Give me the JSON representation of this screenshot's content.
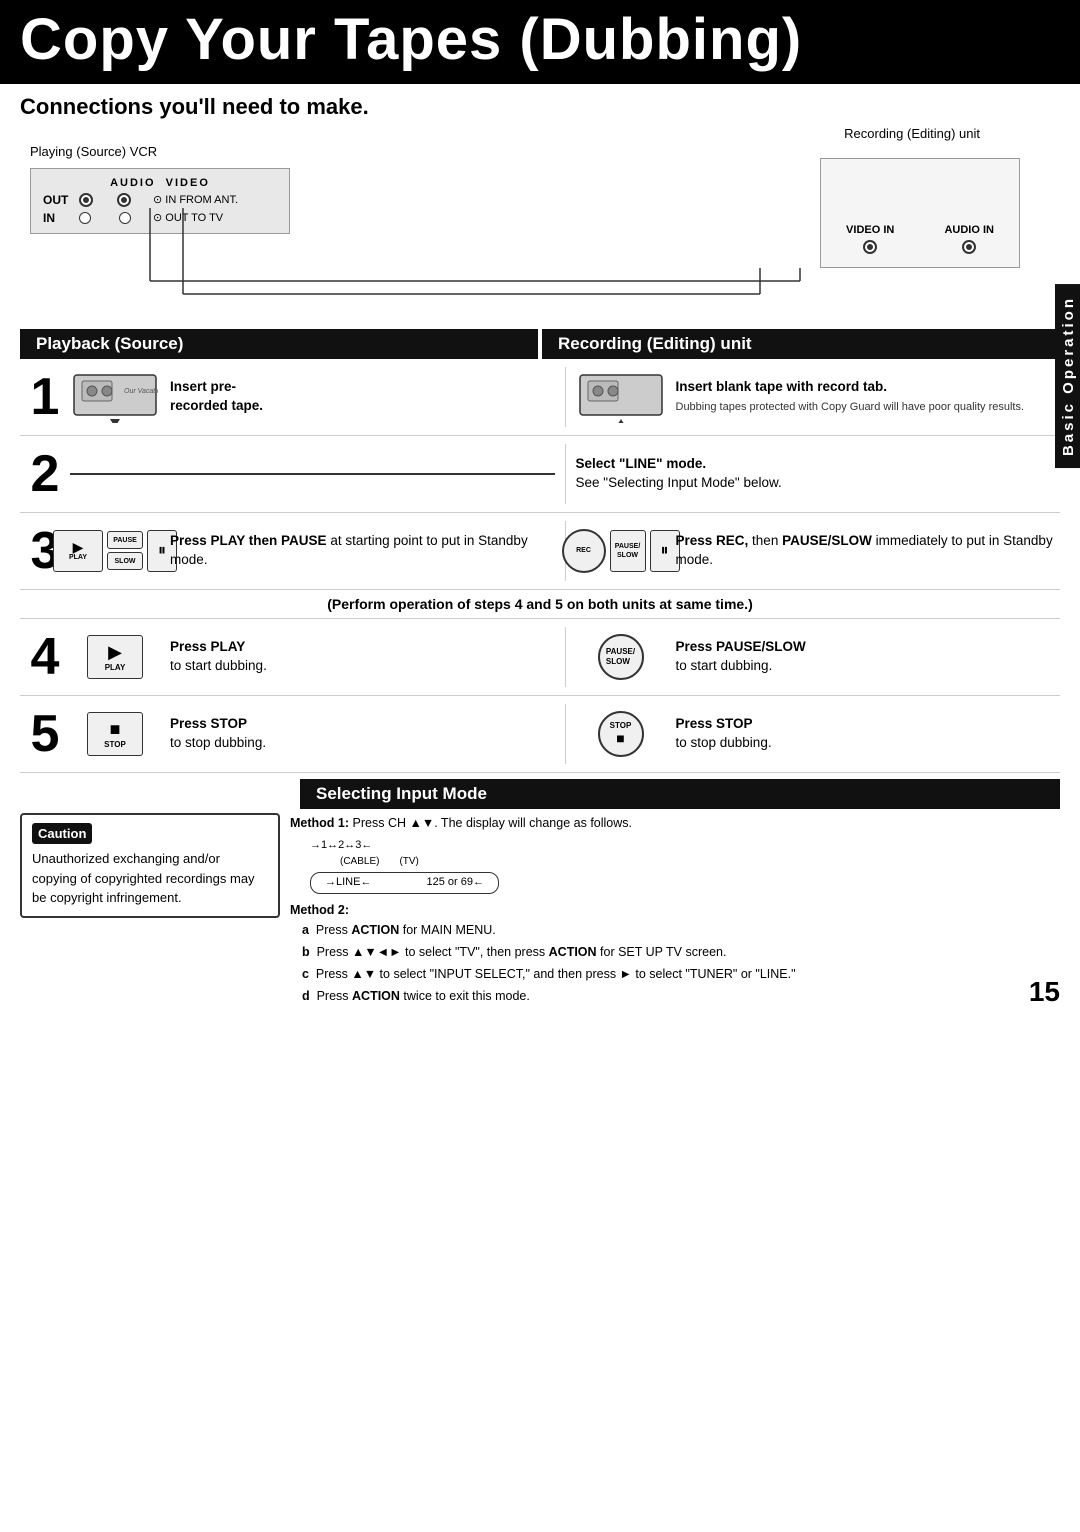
{
  "page": {
    "title": "Copy Your Tapes (Dubbing)",
    "number": "15"
  },
  "header": {
    "title": "Copy Your Tapes (Dubbing)"
  },
  "connections": {
    "title": "Connections you'll need to make.",
    "playing_label": "Playing (Source) VCR",
    "recording_label": "Recording (Editing) unit",
    "vcr_box": {
      "title": "AUDIO  VIDEO",
      "out_label": "OUT",
      "in_label": "IN",
      "in_from_ant": "IN FROM ANT.",
      "out_to_tv": "OUT TO TV"
    },
    "rec_box": {
      "video_in": "VIDEO IN",
      "audio_in": "AUDIO IN"
    }
  },
  "sections": {
    "playback": "Playback (Source)",
    "recording_editing": "Recording (Editing) unit"
  },
  "steps": [
    {
      "number": "1",
      "left": {
        "instruction": "Insert pre-recorded tape."
      },
      "right": {
        "instruction_bold": "Insert blank tape with",
        "instruction": "record tab.",
        "note": "Dubbing tapes protected with Copy Guard will have poor quality results."
      }
    },
    {
      "number": "2",
      "left": {},
      "right": {
        "instruction_bold": "Select “LINE” mode.",
        "instruction": "See “Selecting Input Mode” below."
      }
    },
    {
      "number": "3",
      "left": {
        "instruction_bold": "Press PLAY then",
        "instruction": "PAUSE at starting point to put in Standby mode.",
        "btn1_label": "PLAY",
        "btn2_label": "PAUSE\nSLOW",
        "btn3_label": "II"
      },
      "right": {
        "instruction_bold": "Press REC, then",
        "instruction": "PAUSE/SLOW immediately to put in Standby mode.",
        "btn1_label": "REC",
        "btn2_label": "PAUSE/SLOW",
        "btn3_label": "II"
      }
    },
    {
      "number": "perform",
      "notice": "(Perform operation of steps 4 and 5 on both units at same time.)"
    },
    {
      "number": "4",
      "left": {
        "instruction_bold": "Press PLAY",
        "instruction": "to start dubbing.",
        "btn_label": "PLAY"
      },
      "right": {
        "instruction_bold": "Press PAUSE/SLOW",
        "instruction": "to start dubbing.",
        "btn_label": "PAUSE/SLOW"
      }
    },
    {
      "number": "5",
      "left": {
        "instruction_bold": "Press STOP",
        "instruction": "to stop dubbing.",
        "btn_label": "STOP"
      },
      "right": {
        "instruction_bold": "Press STOP",
        "instruction": "to stop dubbing.",
        "btn_label": "STOP"
      }
    }
  ],
  "selecting_input": {
    "header": "Selecting Input Mode",
    "method1_label": "Method 1:",
    "method1_text": "Press CH ▲▼. The display will change as follows.",
    "channel_sequence": "→1↔2↔3←",
    "cable_label": "(CABLE)",
    "tv_label": "(TV)",
    "line_label": "→LINE←",
    "ch_label": "125  or  69←",
    "method2_label": "Method 2:",
    "steps": [
      {
        "key": "a",
        "text": "Press ACTION for MAIN MENU."
      },
      {
        "key": "b",
        "text": "Press ▲▼◄► to select \"TV\", then press ACTION for SET UP TV screen."
      },
      {
        "key": "c",
        "text": "Press ▲▼ to select \"INPUT SELECT,\" and then press ► to select \"TUNER\" or \"LINE.\""
      },
      {
        "key": "d",
        "text": "Press ACTION twice to exit this mode."
      }
    ]
  },
  "caution": {
    "label": "Caution",
    "text": "Unauthorized exchanging and/or copying of copyrighted recordings may be copyright infringement."
  },
  "sidebar": {
    "label": "Basic Operation"
  }
}
